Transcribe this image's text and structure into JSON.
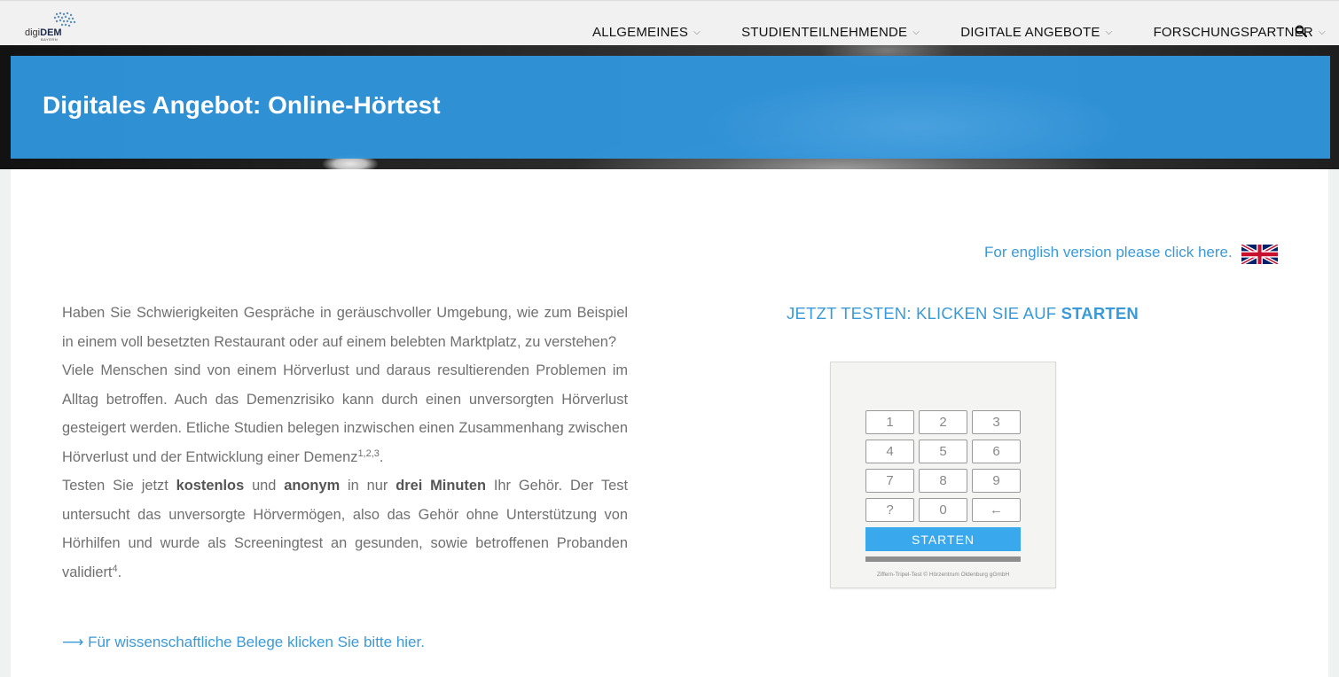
{
  "logo": {
    "prefix": "digi",
    "brand": "DEM",
    "sub": "BAYERN"
  },
  "nav": {
    "items": [
      {
        "label": "ALLGEMEINES"
      },
      {
        "label": "STUDIENTEILNEHMENDE"
      },
      {
        "label": "DIGITALE ANGEBOTE"
      },
      {
        "label": "FORSCHUNGSPARTNER"
      }
    ],
    "icons": {
      "dropdown": "chevron-down-icon",
      "search": "search-icon"
    }
  },
  "hero": {
    "title": "Digitales Angebot: Online-Hörtest"
  },
  "english": {
    "link": "For english version please click here.",
    "flag_icon": "uk-flag-icon"
  },
  "intro": {
    "p1": "Haben Sie Schwierigkeiten Gespräche in geräuschvoller Umgebung, wie zum Beispiel in einem voll besetzten Restaurant oder auf einem belebten Marktplatz, zu verstehen?",
    "p2_text": "Viele Menschen sind von einem Hörverlust und daraus resultierenden Problemen im Alltag betroffen. Auch das Demenzrisiko kann durch einen unversorgten Hörverlust gesteigert werden. Etliche Studien belegen inzwischen einen Zusammenhang zwischen Hörverlust und der Entwicklung einer Demenz",
    "p2_sup": "1,2,3",
    "p2_end": ".",
    "p3_a": "Testen Sie jetzt ",
    "p3_b1": "kostenlos",
    "p3_c": " und ",
    "p3_b2": "anonym",
    "p3_d": " in nur ",
    "p3_b3": "drei Minuten",
    "p3_e": " Ihr Gehör. Der Test untersucht das unversorgte Hörvermögen, also das Gehör ohne Unterstützung von Hörhilfen und wurde als Screeningtest an gesunden, sowie betroffenen Probanden validiert",
    "p3_sup": "4",
    "p3_end": "."
  },
  "science_link": "⟶ Für wissenschaftliche Belege klicken Sie bitte hier.",
  "cta": {
    "text": "JETZT TESTEN: KLICKEN SIE AUF ",
    "bold": "STARTEN"
  },
  "widget": {
    "keys": [
      "1",
      "2",
      "3",
      "4",
      "5",
      "6",
      "7",
      "8",
      "9",
      "?",
      "0",
      "←"
    ],
    "start_label": "STARTEN",
    "footer": "Ziffern-Tripel-Test  ©  Hörzentrum Oldenburg gGmbH"
  },
  "colors": {
    "accent": "#3a9ad9",
    "hero_band": "#3095dc",
    "start_button": "#3aa8ec"
  }
}
